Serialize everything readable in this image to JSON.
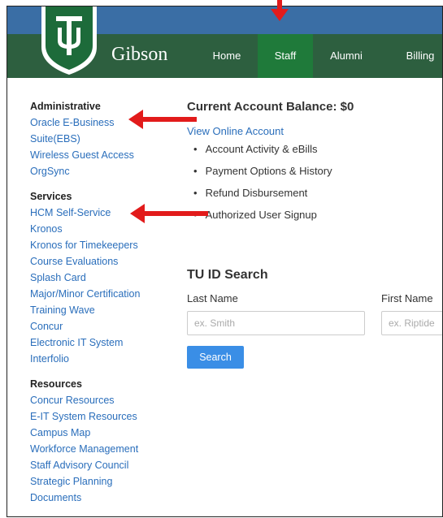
{
  "header": {
    "brand": "Gibson",
    "nav": [
      {
        "label": "Home",
        "active": false
      },
      {
        "label": "Staff",
        "active": true
      },
      {
        "label": "Alumni",
        "active": false
      },
      {
        "label": "Billing",
        "active": false
      }
    ]
  },
  "sidebar": {
    "administrative": {
      "heading": "Administrative",
      "links": [
        "Oracle E-Business",
        "Suite(EBS)",
        "Wireless Guest Access",
        "OrgSync"
      ]
    },
    "services": {
      "heading": "Services",
      "links": [
        "HCM Self-Service",
        "Kronos",
        "Kronos for Timekeepers",
        "Course Evaluations",
        "Splash Card",
        "Major/Minor Certification",
        "Training Wave",
        "Concur",
        "Electronic IT System",
        "Interfolio"
      ]
    },
    "resources": {
      "heading": "Resources",
      "links": [
        "Concur Resources",
        "E-IT System Resources",
        "Campus Map",
        "Workforce Management",
        "Staff Advisory Council",
        "Strategic Planning",
        "Documents"
      ]
    }
  },
  "main": {
    "balance_title": "Current Account Balance: $0",
    "view_link": "View Online Account",
    "bullets": [
      "Account Activity & eBills",
      "Payment Options & History",
      "Refund Disbursement",
      "Authorized User Signup"
    ],
    "search": {
      "title": "TU ID Search",
      "last_name_label": "Last Name",
      "first_name_label": "First Name",
      "last_name_placeholder": "ex. Smith",
      "first_name_placeholder": "ex. Riptide",
      "button_label": "Search"
    }
  },
  "colors": {
    "nav_green": "#2d5f3f",
    "active_green": "#1f7a3a",
    "top_blue": "#3a6ea5",
    "link_blue": "#2a6ebb",
    "arrow_red": "#e21b1b"
  }
}
